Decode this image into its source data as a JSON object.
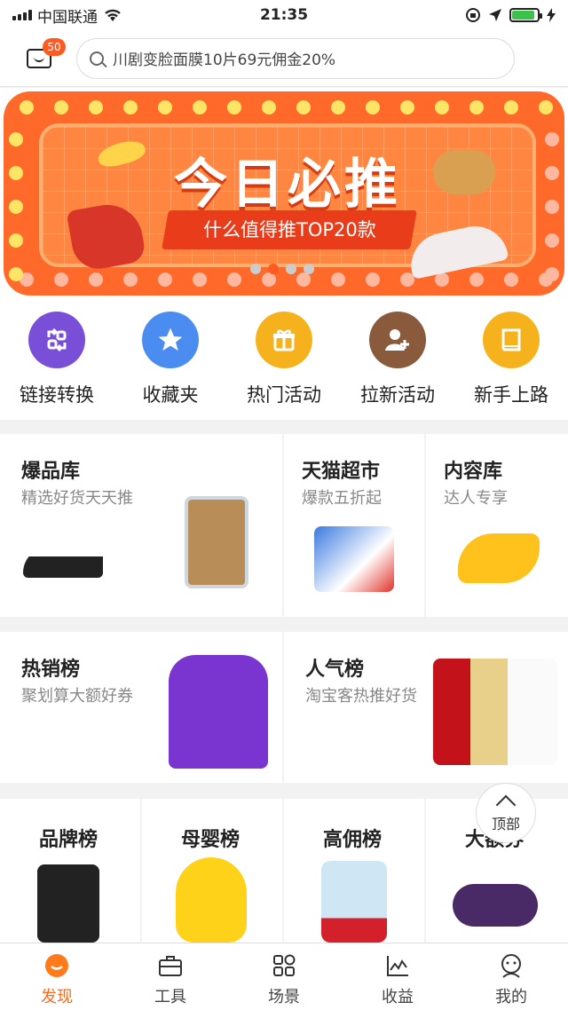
{
  "status_bar": {
    "carrier": "中国联通",
    "time": "21:35"
  },
  "header": {
    "message_badge": "50",
    "search_placeholder": "川剧变脸面膜10片69元佣金20%"
  },
  "banner": {
    "title": "今日必推",
    "subtitle": "什么值得推TOP20款",
    "active_dot": 1,
    "dot_count": 4
  },
  "quick_nav": [
    {
      "label": "链接转换",
      "icon": "link-convert-icon",
      "color": "#7a4fd8"
    },
    {
      "label": "收藏夹",
      "icon": "star-icon",
      "color": "#4a8cf0"
    },
    {
      "label": "热门活动",
      "icon": "gift-icon",
      "color": "#f5b21c"
    },
    {
      "label": "拉新活动",
      "icon": "add-user-icon",
      "color": "#8a5a3c"
    },
    {
      "label": "新手上路",
      "icon": "book-icon",
      "color": "#f5b21c"
    }
  ],
  "cards": {
    "baopin": {
      "title": "爆品库",
      "sub": "精选好货天天推"
    },
    "tmall": {
      "title": "天猫超市",
      "sub": "爆款五折起"
    },
    "content": {
      "title": "内容库",
      "sub": "达人专享"
    },
    "hot_sale": {
      "title": "热销榜",
      "sub": "聚划算大额好券"
    },
    "popular": {
      "title": "人气榜",
      "sub": "淘宝客热推好货"
    },
    "brand": {
      "title": "品牌榜"
    },
    "baby": {
      "title": "母婴榜"
    },
    "commission": {
      "title": "高佣榜"
    },
    "big": {
      "title": "大额券"
    }
  },
  "scroll_top_label": "顶部",
  "tab_bar": [
    {
      "label": "发现",
      "icon": "discover-icon",
      "active": true
    },
    {
      "label": "工具",
      "icon": "toolbox-icon"
    },
    {
      "label": "场景",
      "icon": "scenes-icon"
    },
    {
      "label": "收益",
      "icon": "earnings-chart-icon"
    },
    {
      "label": "我的",
      "icon": "profile-icon"
    }
  ],
  "colors": {
    "accent": "#ff6a1a",
    "badge": "#ff5a1f"
  }
}
